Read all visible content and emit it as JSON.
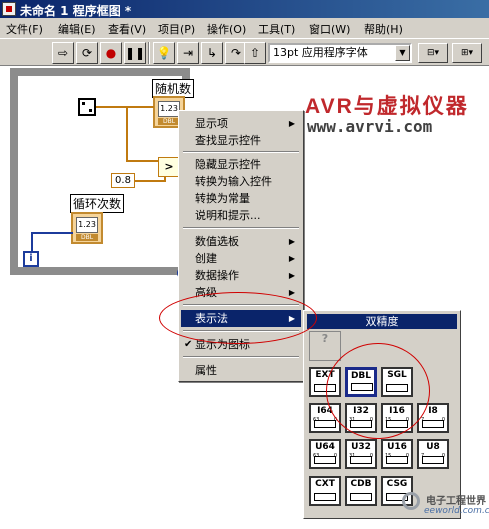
{
  "window": {
    "title": "未命名 1 程序框图 *"
  },
  "menubar": {
    "items": [
      {
        "label": "文件(F)",
        "name": "menu-file"
      },
      {
        "label": "编辑(E)",
        "name": "menu-edit"
      },
      {
        "label": "查看(V)",
        "name": "menu-view"
      },
      {
        "label": "项目(P)",
        "name": "menu-project"
      },
      {
        "label": "操作(O)",
        "name": "menu-operate"
      },
      {
        "label": "工具(T)",
        "name": "menu-tools"
      },
      {
        "label": "窗口(W)",
        "name": "menu-window"
      },
      {
        "label": "帮助(H)",
        "name": "menu-help"
      }
    ]
  },
  "toolbar": {
    "font": "13pt 应用程序字体",
    "buttons": [
      "run-arrow-icon",
      "run-continuous-icon",
      "abort-icon",
      "pause-icon",
      "highlight-execution-icon",
      "step-into-icon",
      "step-over-icon",
      "step-out-icon"
    ]
  },
  "watermark": {
    "title": "AVR与虚拟仪器",
    "url": "www.avrvi.com"
  },
  "diagram": {
    "random_label": "随机数",
    "loop_label": "循环次数",
    "indicator_value": "1.23",
    "indicator_type": "DBL",
    "constant": "0.8",
    "compare": ">",
    "iteration": "i"
  },
  "context_menu": {
    "items": [
      {
        "label": "显示项",
        "submenu": true
      },
      {
        "label": "查找显示控件",
        "submenu": false
      },
      {
        "label": "隐藏显示控件",
        "submenu": false
      },
      {
        "label": "转换为输入控件",
        "submenu": false
      },
      {
        "label": "转换为常量",
        "submenu": false
      },
      {
        "label": "说明和提示...",
        "submenu": false
      },
      {
        "label": "数值选板",
        "submenu": true
      },
      {
        "label": "创建",
        "submenu": true
      },
      {
        "label": "数据操作",
        "submenu": true
      },
      {
        "label": "高级",
        "submenu": true
      },
      {
        "label": "表示法",
        "submenu": true,
        "selected": true
      },
      {
        "label": "显示为图标",
        "checked": true
      },
      {
        "label": "属性",
        "submenu": false
      }
    ]
  },
  "submenu": {
    "title": "双精度",
    "cells": [
      {
        "label": "?",
        "type": "unknown"
      },
      {
        "label": "EXT",
        "type": "float"
      },
      {
        "label": "DBL",
        "type": "float",
        "highlighted": true
      },
      {
        "label": "SGL",
        "type": "float"
      },
      {
        "label": "I64",
        "type": "int",
        "hi": "63",
        "lo": "0"
      },
      {
        "label": "I32",
        "type": "int",
        "hi": "31",
        "lo": "0"
      },
      {
        "label": "I16",
        "type": "int",
        "hi": "15",
        "lo": "0"
      },
      {
        "label": "I8",
        "type": "int",
        "hi": "7",
        "lo": "0"
      },
      {
        "label": "U64",
        "type": "int",
        "hi": "63",
        "lo": "0"
      },
      {
        "label": "U32",
        "type": "int",
        "hi": "31",
        "lo": "0"
      },
      {
        "label": "U16",
        "type": "int",
        "hi": "15",
        "lo": "0"
      },
      {
        "label": "U8",
        "type": "int",
        "hi": "7",
        "lo": "0"
      },
      {
        "label": "CXT",
        "type": "complex"
      },
      {
        "label": "CDB",
        "type": "complex"
      },
      {
        "label": "CSG",
        "type": "complex"
      }
    ]
  },
  "logo": {
    "cn": "电子工程世界",
    "en": "eeworld.com.cn"
  }
}
